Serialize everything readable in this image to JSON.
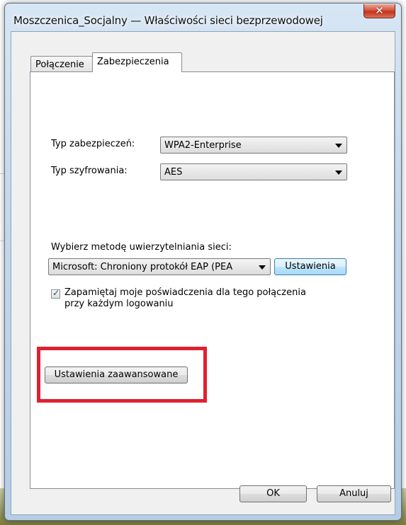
{
  "window": {
    "title": "Moszczenica_Socjalny — Właściwości sieci bezprzewodowej",
    "close_glyph": "✕"
  },
  "tabs": [
    {
      "label": "Połączenie",
      "active": false
    },
    {
      "label": "Zabezpieczenia",
      "active": true
    }
  ],
  "security": {
    "type_label": "Typ zabezpieczeń:",
    "type_value": "WPA2-Enterprise",
    "encryption_label": "Typ szyfrowania:",
    "encryption_value": "AES",
    "auth_label": "Wybierz metodę uwierzytelniania sieci:",
    "auth_value": "Microsoft: Chroniony protokół EAP (PEA",
    "settings_button": "Ustawienia",
    "remember_checked": true,
    "remember_line1": "Zapamiętaj moje poświadczenia dla tego połączenia",
    "remember_line2": "przy każdym logowaniu",
    "advanced_button": "Ustawienia zaawansowane"
  },
  "footer": {
    "ok": "OK",
    "cancel": "Anuluj"
  },
  "colors": {
    "highlight": "#e02030",
    "close_button": "#c33218"
  },
  "icons": {
    "close": "close-icon",
    "dropdown": "chevron-down-icon",
    "checkbox": "checkmark-icon"
  }
}
